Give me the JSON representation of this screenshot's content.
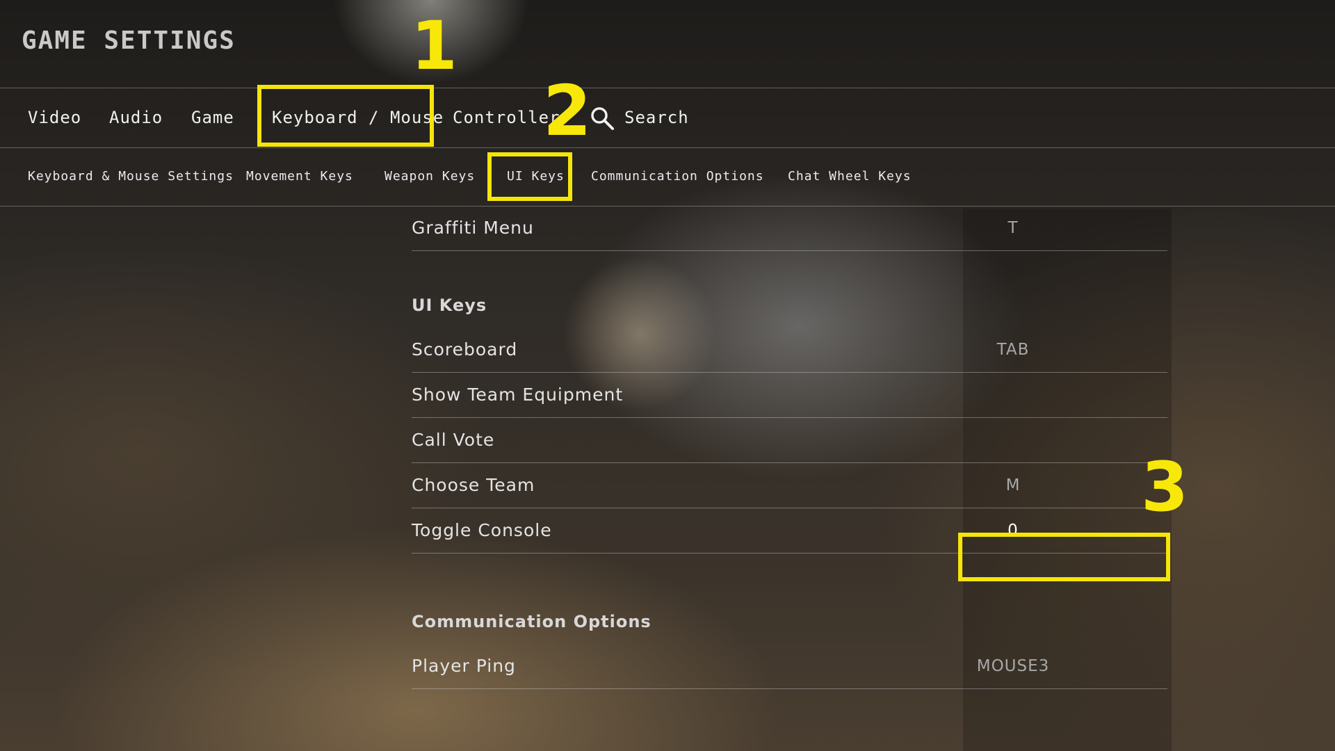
{
  "header": {
    "title": "GAME SETTINGS"
  },
  "top_tabs": [
    {
      "label": "Video"
    },
    {
      "label": "Audio"
    },
    {
      "label": "Game"
    },
    {
      "label": "Keyboard / Mouse",
      "selected": true
    },
    {
      "label": "Controller"
    },
    {
      "label": "Search",
      "icon": "search-icon"
    }
  ],
  "sub_tabs": [
    {
      "label": "Keyboard & Mouse Settings"
    },
    {
      "label": "Movement Keys"
    },
    {
      "label": "Weapon Keys"
    },
    {
      "label": "UI Keys",
      "selected": true
    },
    {
      "label": "Communication Options"
    },
    {
      "label": "Chat Wheel Keys"
    }
  ],
  "bindings": {
    "graffiti": {
      "label": "Graffiti Menu",
      "key": "T"
    },
    "ui_keys_heading": "UI Keys",
    "scoreboard": {
      "label": "Scoreboard",
      "key": "TAB"
    },
    "show_team_equipment": {
      "label": "Show Team Equipment",
      "key": ""
    },
    "call_vote": {
      "label": "Call Vote",
      "key": ""
    },
    "choose_team": {
      "label": "Choose Team",
      "key": "M"
    },
    "toggle_console": {
      "label": "Toggle Console",
      "key": "0"
    },
    "communication_heading": "Communication Options",
    "player_ping": {
      "label": "Player Ping",
      "key": "MOUSE3"
    }
  },
  "annotations": {
    "marker_1": "1",
    "marker_2": "2",
    "marker_3": "3",
    "highlight_color": "#f5e50a"
  }
}
